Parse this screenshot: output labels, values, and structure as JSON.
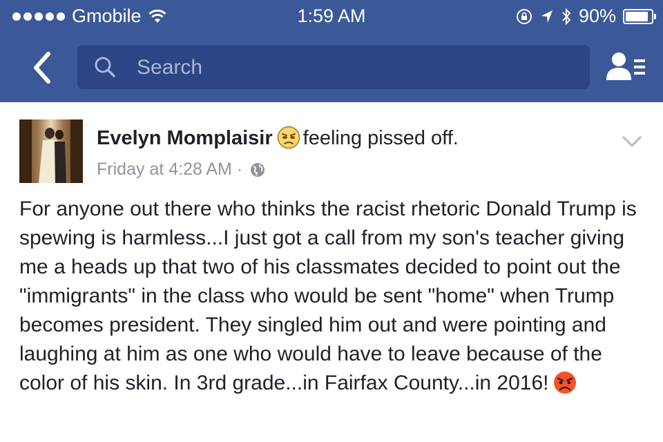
{
  "status_bar": {
    "carrier": "Gmobile",
    "time": "1:59 AM",
    "battery": "90%",
    "battery_level": 0.9,
    "icons": [
      "signal-dots-icon",
      "wifi-icon",
      "rotation-lock-icon",
      "location-icon",
      "bluetooth-icon",
      "battery-icon"
    ]
  },
  "nav": {
    "back_icon": "back-chevron-icon",
    "search_placeholder": "Search",
    "friends_icon": "friend-requests-icon"
  },
  "post": {
    "author": "Evelyn Momplaisir",
    "feeling_icon": "pissed-off-face-icon",
    "feeling_text": "feeling pissed off.",
    "timestamp": "Friday at 4:28 AM",
    "separator": "·",
    "privacy_icon": "globe-icon",
    "options_icon": "chevron-down-icon",
    "body": "For anyone out there who thinks the racist rhetoric Donald Trump is spewing is harmless...I just got a call from my son's teacher giving me a heads up that two of his classmates decided to point out the \"immigrants\" in the class who would be sent \"home\" when Trump becomes president. They singled him out and were pointing and laughing at him as one who would have to leave because of the color of his skin. In 3rd grade...in Fairfax County...in 2016!",
    "end_emoji": "angry-face-icon"
  },
  "colors": {
    "brand": "#3b5998",
    "search_bg": "#2c4584",
    "text": "#1d2129",
    "meta": "#90949c",
    "background": "#ffffff"
  }
}
